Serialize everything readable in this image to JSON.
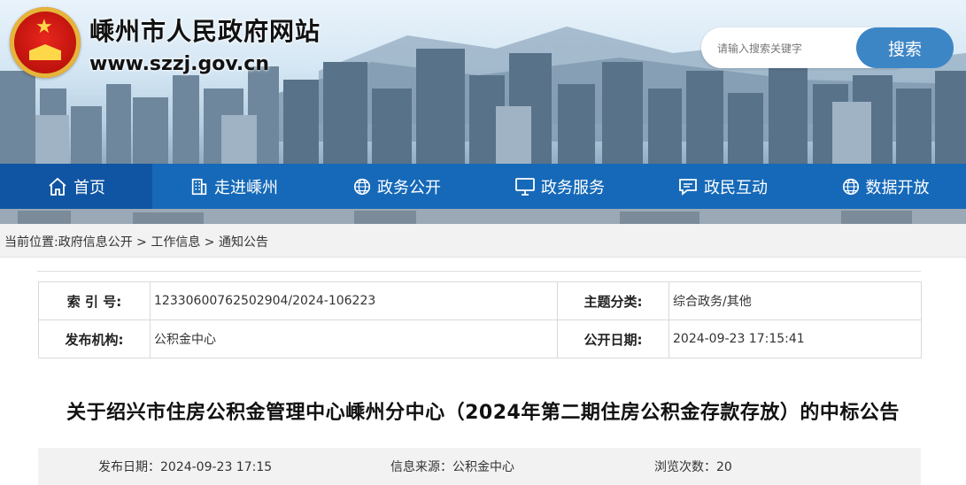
{
  "site": {
    "title": "嵊州市人民政府网站",
    "url": "www.szzj.gov.cn"
  },
  "search": {
    "placeholder": "请输入搜索关键字",
    "button_label": "搜索"
  },
  "nav": {
    "items": [
      {
        "label": "首页",
        "icon": "home-icon",
        "active": true
      },
      {
        "label": "走进嵊州",
        "icon": "building-icon"
      },
      {
        "label": "政务公开",
        "icon": "globe-icon"
      },
      {
        "label": "政务服务",
        "icon": "monitor-icon"
      },
      {
        "label": "政民互动",
        "icon": "chat-icon"
      },
      {
        "label": "数据开放",
        "icon": "globe-icon"
      }
    ]
  },
  "breadcrumb": {
    "prefix": "当前位置:",
    "items": [
      "政府信息公开",
      "工作信息",
      "通知公告"
    ],
    "separator": " > "
  },
  "meta": {
    "index_label": "索 引 号:",
    "index_value": "12330600762502904/2024-106223",
    "topic_label": "主题分类:",
    "topic_value": "综合政务/其他",
    "publisher_label": "发布机构:",
    "publisher_value": "公积金中心",
    "date_label": "公开日期:",
    "date_value": "2024-09-23 17:15:41"
  },
  "article": {
    "title": "关于绍兴市住房公积金管理中心嵊州分中心（2024年第二期住房公积金存款存放）的中标公告",
    "publish_date": "发布日期：2024-09-23 17:15",
    "source": "信息来源：公积金中心",
    "views": "浏览次数：20"
  },
  "colors": {
    "nav_bg": "#1669b8",
    "nav_active": "#0f55a3",
    "search_button": "#3d86c6"
  }
}
